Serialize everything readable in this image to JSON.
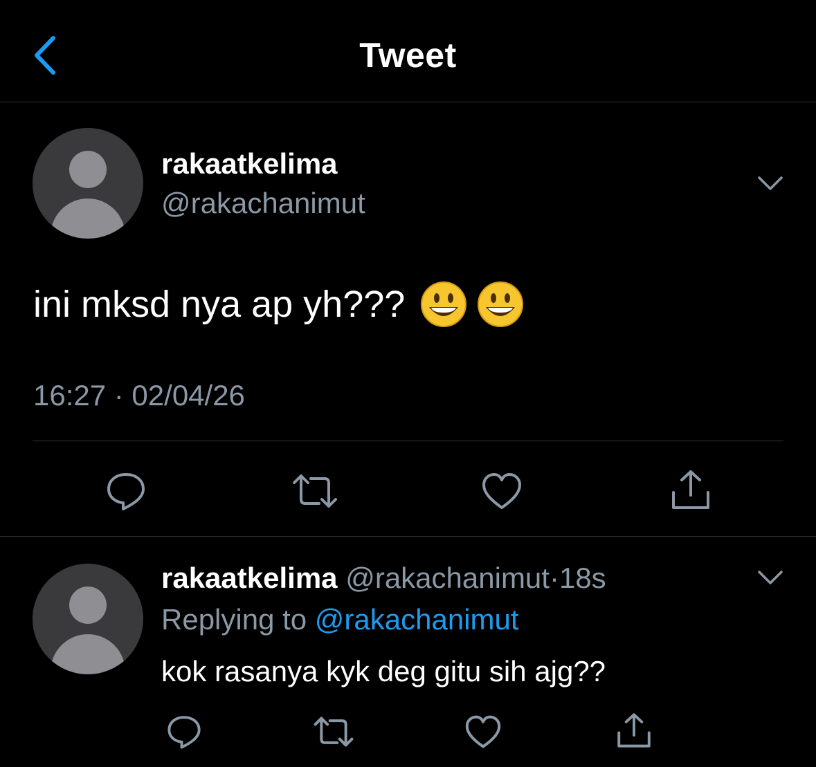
{
  "header": {
    "title": "Tweet",
    "back_icon": "chevron-left-icon",
    "accent_color": "#1d9bf0"
  },
  "main_tweet": {
    "display_name": "rakaatkelima",
    "handle": "@rakachanimut",
    "text": "ini mksd nya ap yh???",
    "emojis": [
      "smiley-emoji",
      "smiley-emoji"
    ],
    "timestamp": "16:27 · 02/04/26",
    "actions": [
      "reply-icon",
      "retweet-icon",
      "like-icon",
      "share-icon"
    ]
  },
  "reply_tweet": {
    "display_name": "rakaatkelima",
    "handle": "@rakachanimut",
    "separator": "·",
    "time_ago": "18s",
    "replying_prefix": "Replying to",
    "replying_to": "@rakachanimut",
    "text": "kok rasanya kyk deg gitu sih ajg??",
    "actions": [
      "reply-icon",
      "retweet-icon",
      "like-icon",
      "share-icon"
    ]
  },
  "colors": {
    "background": "#000000",
    "text": "#ffffff",
    "muted": "#8b98a5",
    "link": "#1d9bf0",
    "divider": "#2f3336"
  }
}
